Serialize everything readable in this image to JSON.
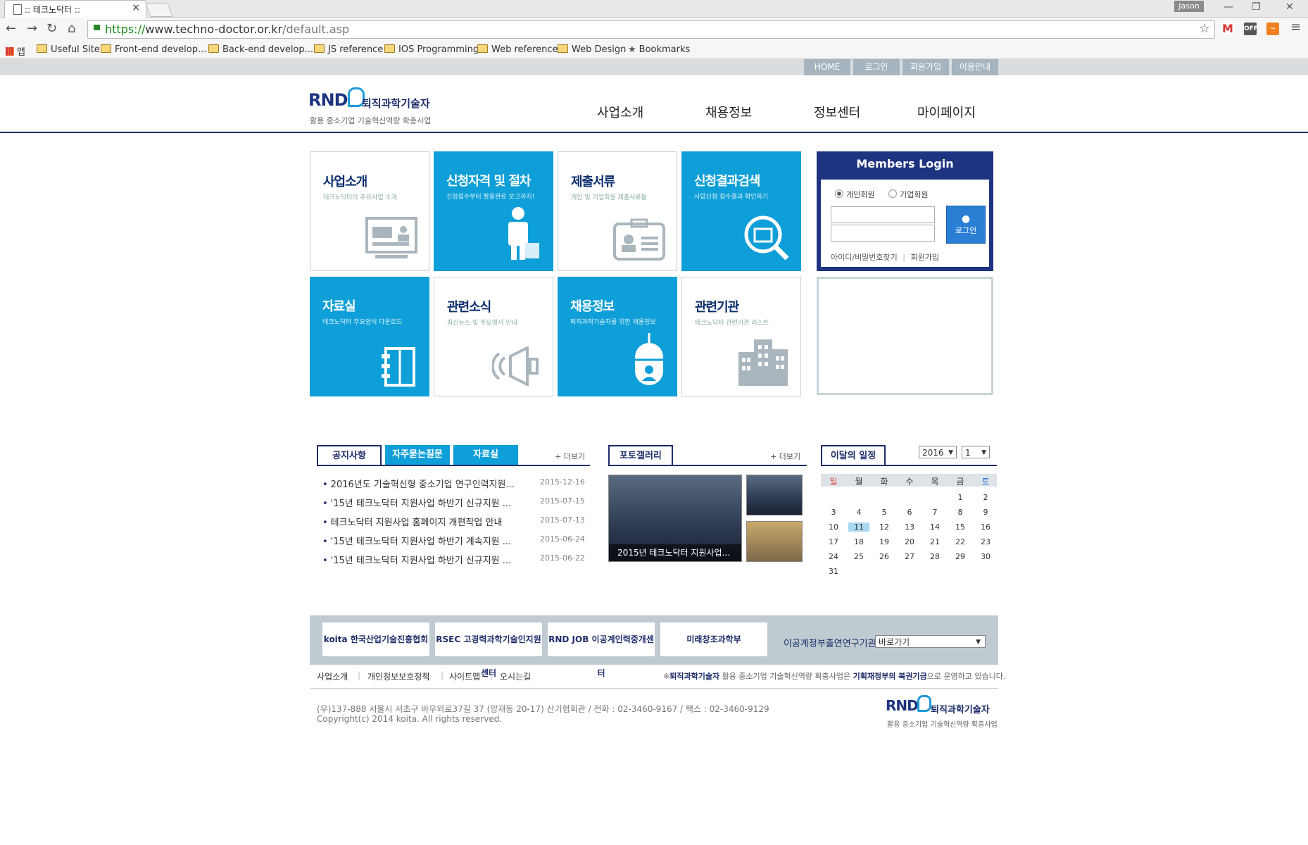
{
  "browser": {
    "tab_title": ":: 테크노닥터 ::",
    "tab_close": "×",
    "user": "Jason",
    "url_scheme": "https://",
    "url_host": "www.techno-doctor.or.kr",
    "url_path": "/default.asp",
    "bookmarks": [
      "앱",
      "Useful Site",
      "Front-end develop...",
      "Back-end develop...",
      "JS reference",
      "IOS Programming",
      "Web reference",
      "Web Design",
      "Bookmarks"
    ],
    "extensions": [
      "OFF"
    ]
  },
  "util_nav": [
    "HOME",
    "로그인",
    "회원가입",
    "이용안내"
  ],
  "logo": {
    "mark": "RND",
    "name": "퇴직과학기술자",
    "sub": "활용 중소기업 기술혁신역량 확충사업"
  },
  "gnb": [
    "사업소개",
    "채용정보",
    "정보센터",
    "마이페이지"
  ],
  "tiles": [
    {
      "title": "사업소개",
      "sub": "테크노닥터의 주요사업 소개"
    },
    {
      "title": "신청자격 및 절차",
      "sub": "신청접수부터 활동완료 보고까지!"
    },
    {
      "title": "제출서류",
      "sub": "개인 및 기업회원 제출서류들"
    },
    {
      "title": "신청결과검색",
      "sub": "사업신청 접수결과 확인하기"
    },
    {
      "title": "자료실",
      "sub": "테크노닥터 주요양식 다운로드"
    },
    {
      "title": "관련소식",
      "sub": "최신뉴스 및 주요행사 안내"
    },
    {
      "title": "채용정보",
      "sub": "퇴직과학기술자를 위한 채용정보"
    },
    {
      "title": "관련기관",
      "sub": "테크노닥터 관련기관 리스트"
    }
  ],
  "login": {
    "title": "Members Login",
    "radio_personal": "개인회원",
    "radio_company": "기업회원",
    "button": "로그인",
    "find": "아이디/비밀번호찾기",
    "join": "회원가입"
  },
  "board": {
    "tabs": [
      "공지사항",
      "자주묻는질문",
      "자료실"
    ],
    "more": "+ 더보기",
    "items": [
      {
        "title": "2016년도 기술혁신형 중소기업 연구인력지원...",
        "date": "2015-12-16"
      },
      {
        "title": "'15년 테크노닥터 지원사업 하반기 신규지원 ...",
        "date": "2015-07-15"
      },
      {
        "title": "테크노닥터 지원사업 홈페이지 개편작업 안내",
        "date": "2015-07-13"
      },
      {
        "title": "'15년 테크노닥터 지원사업 하반기 계속지원 ...",
        "date": "2015-06-24"
      },
      {
        "title": "'15년 테크노닥터 지원사업 하반기 신규지원 ...",
        "date": "2015-06-22"
      }
    ]
  },
  "gallery": {
    "tab": "포토갤러리",
    "more": "+ 더보기",
    "caption": "2015년 테크노닥터 지원사업..."
  },
  "calendar": {
    "tab": "이달의 일정",
    "year": "2016",
    "month": "1",
    "weekdays": [
      "일",
      "월",
      "화",
      "수",
      "목",
      "금",
      "토"
    ],
    "weeks": [
      [
        "",
        "",
        "",
        "",
        "",
        "1",
        "2"
      ],
      [
        "3",
        "4",
        "5",
        "6",
        "7",
        "8",
        "9"
      ],
      [
        "10",
        "11",
        "12",
        "13",
        "14",
        "15",
        "16"
      ],
      [
        "17",
        "18",
        "19",
        "20",
        "21",
        "22",
        "23"
      ],
      [
        "24",
        "25",
        "26",
        "27",
        "28",
        "29",
        "30"
      ],
      [
        "31",
        "",
        "",
        "",
        "",
        "",
        ""
      ]
    ],
    "today": "11",
    "colors": {
      "sunday": "#e04040",
      "saturday": "#1e6fd0",
      "today_bg": "#a9d8f0"
    }
  },
  "footer": {
    "banners": [
      "koita 한국산업기술진흥협회",
      "RSEC 고경력과학기술인지원센터",
      "RND JOB 이공계인력중개센터",
      "미래창조과학부"
    ],
    "family_label": "이공계정부출연연구기관",
    "family_select": "바로가기",
    "links": [
      "사업소개",
      "개인정보보호정책",
      "사이트맵",
      "오시는길"
    ],
    "note_pre": "※",
    "note_b1": "퇴직과학기술자",
    "note_mid": " 활용 중소기업 기술혁신역량 확충사업은 ",
    "note_b2": "기획재정부의 복권기금",
    "note_post": "으로 운영하고 있습니다.",
    "address": "(우)137-888 서울시 서초구 바우뫼로37길 37 (양재동 20-17) 산기협회관 / 전화 : 02-3460-9167 / 팩스 : 02-3460-9129",
    "copyright": "Copyright(c) 2014 koita. All rights reserved.",
    "logo_mark": "RND",
    "logo_name": "퇴직과학기술자",
    "logo_sub": "활용 중소기업 기술혁신역량 확충사업"
  },
  "colors": {
    "navy": "#1e2c6a",
    "blue": "#0f9fd8"
  }
}
